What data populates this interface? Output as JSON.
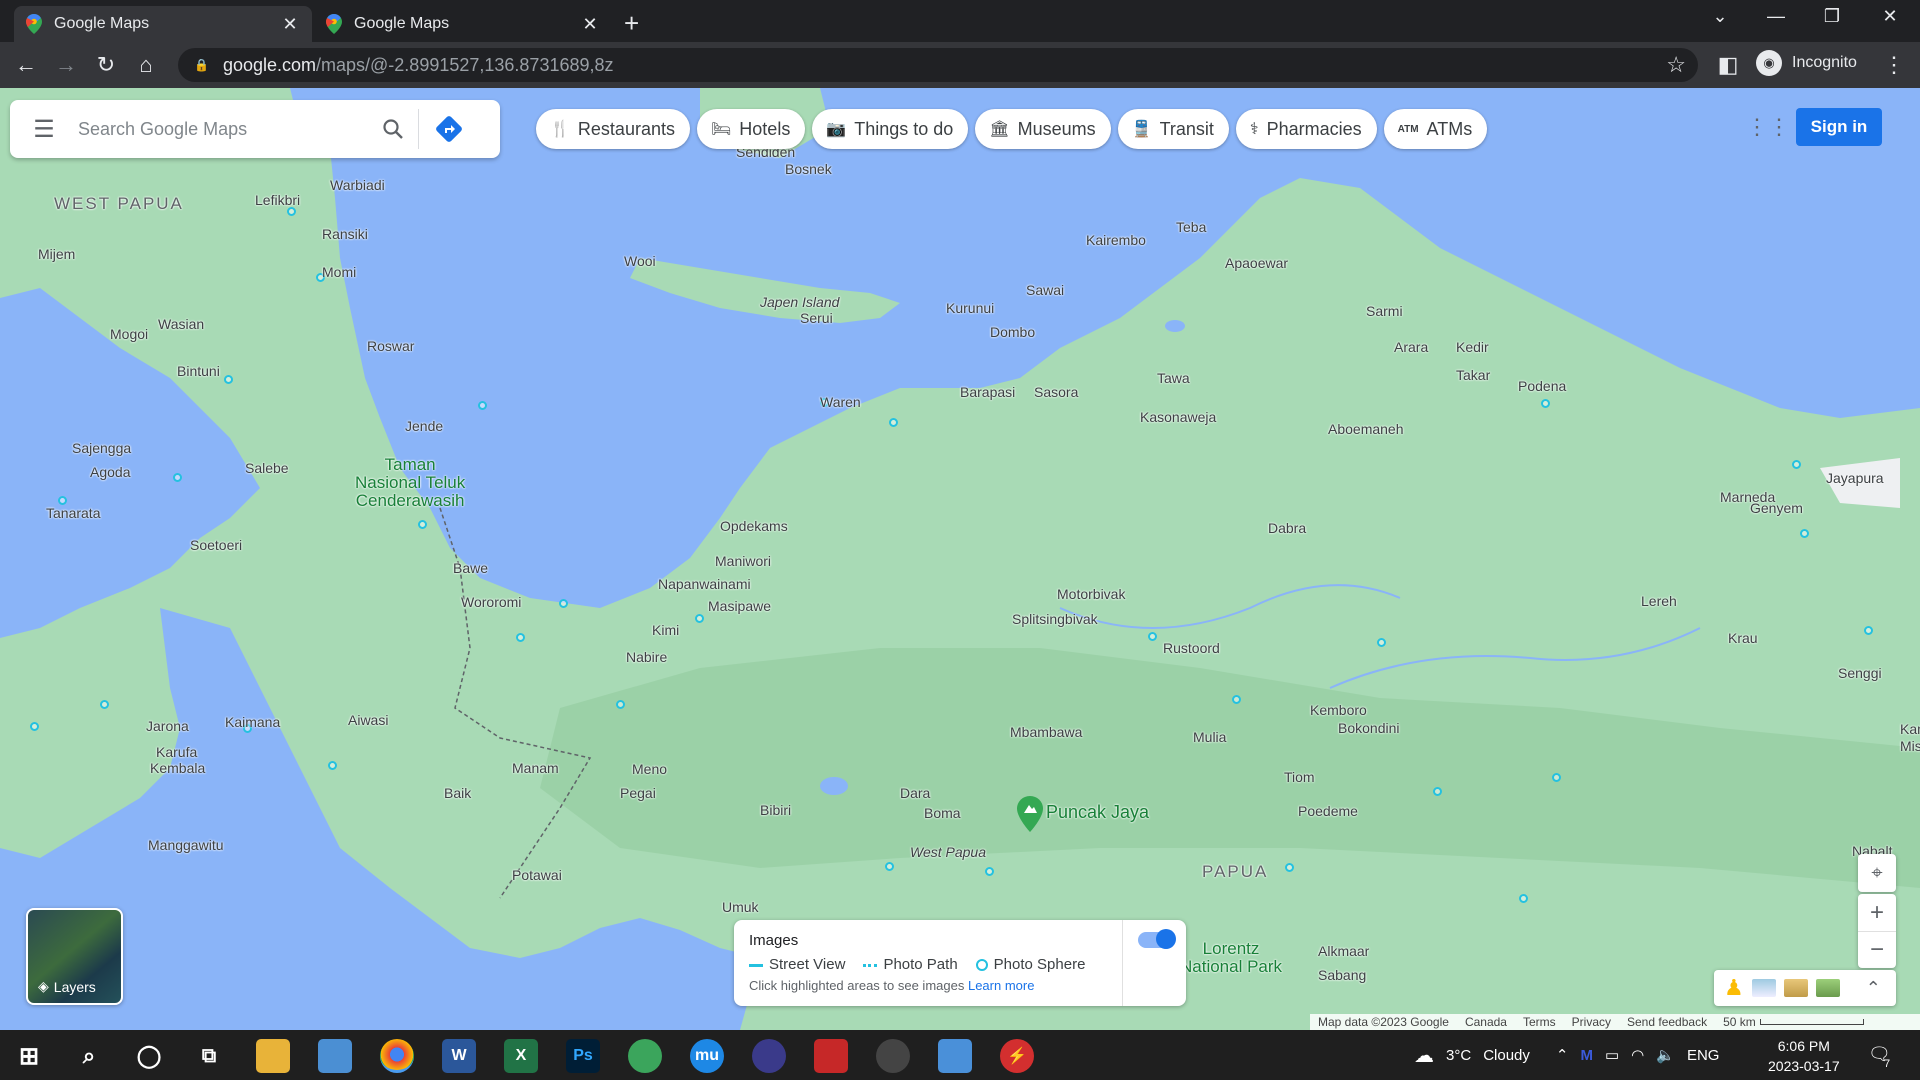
{
  "browser": {
    "tabs": [
      {
        "title": "Google Maps"
      },
      {
        "title": "Google Maps"
      }
    ],
    "url_host": "google.com",
    "url_path": "/maps/@-2.8991527,136.8731689,8z",
    "profile_label": "Incognito"
  },
  "maps": {
    "search_placeholder": "Search Google Maps",
    "chips": [
      {
        "label": "Restaurants",
        "icon": "fork-knife-icon"
      },
      {
        "label": "Hotels",
        "icon": "bed-icon"
      },
      {
        "label": "Things to do",
        "icon": "camera-icon"
      },
      {
        "label": "Museums",
        "icon": "museum-icon"
      },
      {
        "label": "Transit",
        "icon": "train-icon"
      },
      {
        "label": "Pharmacies",
        "icon": "pharmacy-icon"
      },
      {
        "label": "ATMs",
        "icon": "atm-icon"
      }
    ],
    "sign_in": "Sign in",
    "layers_label": "Layers",
    "images_panel": {
      "title": "Images",
      "legend": [
        "Street View",
        "Photo Path",
        "Photo Sphere"
      ],
      "hint": "Click highlighted areas to see images",
      "learn_more": "Learn more"
    },
    "attribution": {
      "map_data": "Map data ©2023 Google",
      "links": [
        "Canada",
        "Terms",
        "Privacy",
        "Send feedback"
      ],
      "scale": "50 km"
    },
    "places": {
      "west_papua_region": "WEST PAPUA",
      "papua_region": "PAPUA",
      "park1a": "Taman",
      "park1b": "Nasional Teluk",
      "park1c": "Cenderawasih",
      "park2a": "Lorentz",
      "park2b": "National Park",
      "puncak_jaya": "Puncak Jaya",
      "west_papua_italic": "West Papua",
      "japen": "Japen Island",
      "names": [
        "Lefikbri",
        "Warbiadi",
        "Ransiki",
        "Momi",
        "Mijem",
        "Mogoi",
        "Wasian",
        "Bintuni",
        "Roswar",
        "Sajengga",
        "Agoda",
        "Salebe",
        "Tanarata",
        "Soetoeri",
        "Jende",
        "Bawe",
        "Wororomi",
        "Jarona",
        "Karufa",
        "Kembala",
        "Kaimana",
        "Aiwasi",
        "Manam",
        "Baik",
        "Manggawitu",
        "Potawai",
        "Meno",
        "Pegai",
        "Bibiri",
        "Umuk",
        "Dara",
        "Boma",
        "Mbambawa",
        "Mulia",
        "Tiom",
        "Kemboro",
        "Bokondini",
        "Poedeme",
        "Alkmaar",
        "Sabang",
        "Rustoord",
        "Motorbivak",
        "Splitsingbivak",
        "Dabra",
        "Lereh",
        "Krau",
        "Senggi",
        "Marneda",
        "Genyem",
        "Jayapura",
        "Podena",
        "Takar",
        "Arara",
        "Kedir",
        "Sarmi",
        "Aboemaneh",
        "Kasonaweja",
        "Tawa",
        "Apaoewar",
        "Teba",
        "Kairembo",
        "Sawai",
        "Kurunui",
        "Dombo",
        "Barapasi",
        "Sasora",
        "Waren",
        "Serui",
        "Wooi",
        "Opdekams",
        "Maniwori",
        "Napanwainami",
        "Masipawe",
        "Kimi",
        "Nabire",
        "Bosnek",
        "Sendiden",
        "Nabalt",
        "Kamber",
        "Missi"
      ]
    }
  },
  "taskbar": {
    "weather_temp": "3°C",
    "weather_text": "Cloudy",
    "language": "ENG",
    "time": "6:06 PM",
    "date": "2023-03-17",
    "notification_count": "7"
  },
  "colors": {
    "water": "#8ab4f8",
    "land": "#a8dab5",
    "accent": "#1a73e8",
    "poi": "#24c1e0"
  }
}
